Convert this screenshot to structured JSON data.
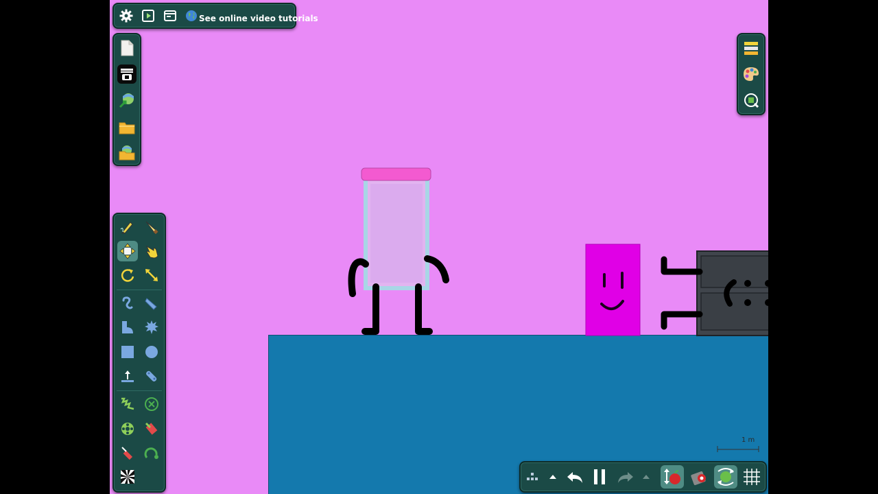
{
  "top_toolbar": {
    "settings_icon": "gear-icon",
    "play_icon": "play-icon",
    "window_icon": "window-icon",
    "globe_icon": "globe-icon",
    "tutorials_label": "See online video tutorials"
  },
  "file_tools": [
    "new-file-icon",
    "save-icon",
    "export-image-icon",
    "open-folder-icon",
    "open-image-folder-icon"
  ],
  "right_tools": [
    "layers-icon",
    "palette-icon",
    "zoom-icon"
  ],
  "draw_tools": [
    [
      "pencil-icon",
      "knife-icon"
    ],
    [
      "move-icon",
      "drag-hand-icon"
    ],
    [
      "rotate-icon",
      "scale-icon"
    ],
    [
      "rope-icon",
      "brush-icon"
    ],
    [
      "polygon-icon",
      "gear-shape-icon"
    ],
    [
      "box-icon",
      "circle-icon"
    ],
    [
      "thruster-icon",
      "plank-icon"
    ],
    [
      "spring-icon",
      "fixate-icon"
    ],
    [
      "hinge-icon",
      "tracer-icon"
    ],
    [
      "laser-icon",
      "axle-icon"
    ],
    [
      "texture-icon"
    ]
  ],
  "bottom_toolbar": {
    "icons": [
      "grid-settings-icon",
      "chevron-up-icon",
      "undo-icon",
      "pause-icon",
      "redo-icon",
      "chevron-up-icon",
      "gravity-icon",
      "collision-icon",
      "shape-toggle-icon",
      "grid-icon"
    ]
  },
  "scene": {
    "scale_label": "1 m",
    "colors": {
      "background": "#e98af7",
      "ground": "#1479ad",
      "glass_lid": "#f35ad0",
      "box": "#e000e6",
      "cabinet": "#40454c"
    }
  }
}
